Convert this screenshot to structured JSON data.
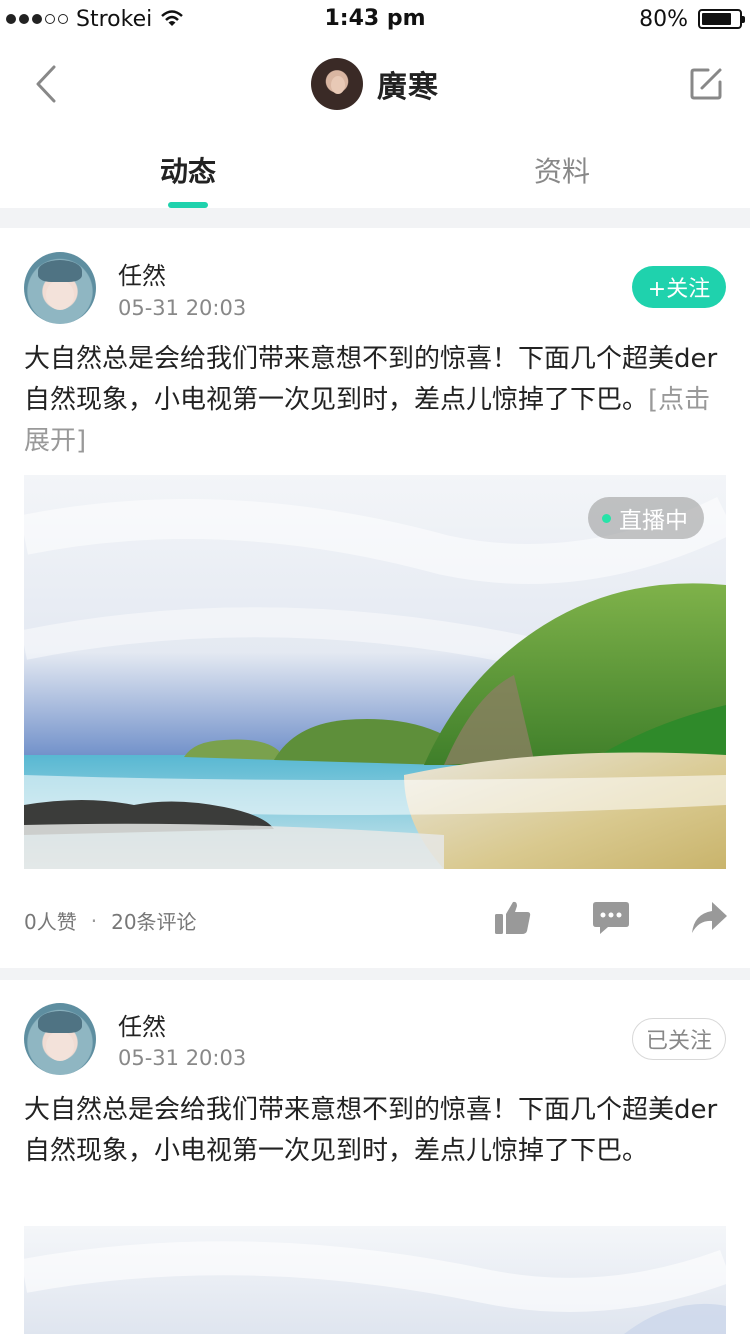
{
  "status_bar": {
    "carrier": "Strokei",
    "time": "1:43 pm",
    "battery": "80%",
    "battery_level": 0.8
  },
  "nav": {
    "title": "廣寒",
    "back_icon": "chevron-left-icon",
    "edit_icon": "edit-icon"
  },
  "tabs": [
    {
      "label": "动态",
      "active": true
    },
    {
      "label": "资料",
      "active": false
    }
  ],
  "accent_color": "#1fd2ad",
  "posts": [
    {
      "author": "任然",
      "time": "05-31  20:03",
      "follow_label": "+关注",
      "text": "大自然总是会给我们带来意想不到的惊喜！下面几个超美der自然现象，小电视第一次见到时，差点儿惊掉了下巴。",
      "expand_label": "[点击展开]",
      "live_label": "直播中",
      "likes": "0人赞",
      "dot": "·",
      "comments": "20条评论"
    },
    {
      "author": "任然",
      "time": "05-31  20:03",
      "follow_label": "已关注",
      "text": "大自然总是会给我们带来意想不到的惊喜！下面几个超美der自然现象，小电视第一次见到时，差点儿惊掉了下巴。"
    }
  ]
}
